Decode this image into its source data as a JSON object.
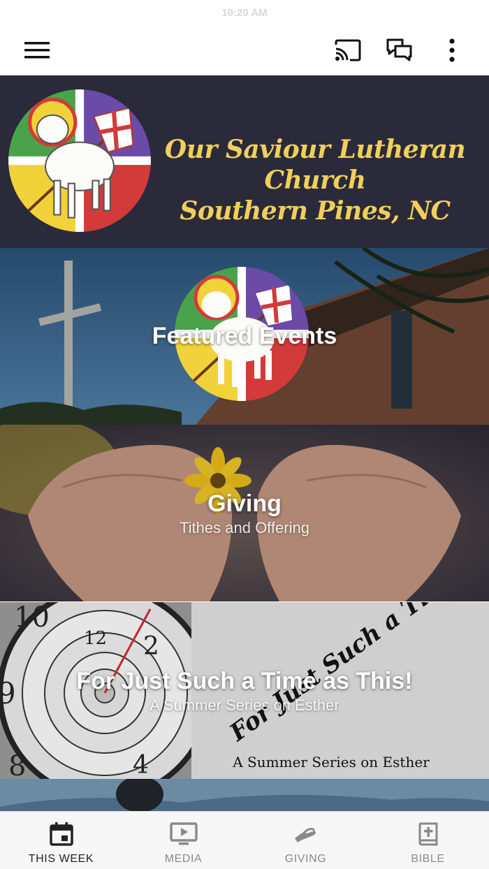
{
  "status_bar": {
    "time": "10:20 AM"
  },
  "app_bar": {
    "icons": [
      "hamburger-menu-icon",
      "cast-icon",
      "chat-icon",
      "more-vertical-icon"
    ]
  },
  "header": {
    "church_name_line1": "Our Saviour Lutheran Church",
    "church_name_line2": "Southern Pines, NC",
    "accent_color": "#f0cf5a",
    "background_color": "#2b2a3b"
  },
  "tiles": [
    {
      "title": "Featured Events",
      "subtitle": ""
    },
    {
      "title": "Giving",
      "subtitle": "Tithes and Offering"
    },
    {
      "title": "For Just Such a Time as This!",
      "subtitle": "A Summer Series on Esther",
      "image_text": "For Just Such a Time as This!",
      "image_caption": "A Summer Series on Esther"
    }
  ],
  "bottom_nav": {
    "items": [
      {
        "label": "THIS WEEK",
        "icon": "calendar-icon",
        "active": true
      },
      {
        "label": "MEDIA",
        "icon": "media-play-icon",
        "active": false
      },
      {
        "label": "GIVING",
        "icon": "giving-hand-icon",
        "active": false
      },
      {
        "label": "BIBLE",
        "icon": "bible-icon",
        "active": false
      }
    ]
  }
}
